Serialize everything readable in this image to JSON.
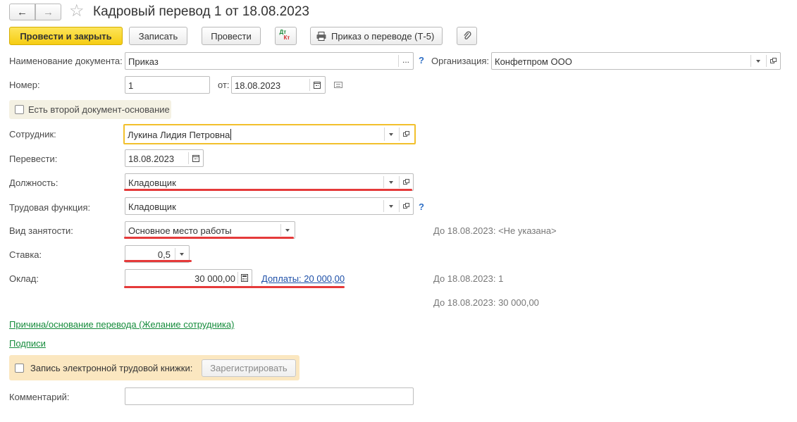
{
  "window": {
    "title": "Кадровый перевод 1 от 18.08.2023"
  },
  "toolbar": {
    "post_close_label": "Провести и закрыть",
    "save_label": "Записать",
    "post_label": "Провести",
    "dtkt_top": "Дт",
    "dtkt_bottom": "Кт",
    "print_label": "Приказ о переводе (Т-5)"
  },
  "form": {
    "doc_name_label": "Наименование документа:",
    "doc_name_value": "Приказ",
    "doc_name_more": "...",
    "help_mark": "?",
    "org_label": "Организация:",
    "org_value": "Конфетпром ООО",
    "number_label": "Номер:",
    "number_value": "1",
    "from_label": "от:",
    "from_value": "18.08.2023",
    "second_doc_label": "Есть второй документ-основание",
    "employee_label": "Сотрудник:",
    "employee_value": "Лукина Лидия Петровна",
    "transfer_label": "Перевести:",
    "transfer_value": "18.08.2023",
    "position_label": "Должность:",
    "position_value": "Кладовщик",
    "labor_function_label": "Трудовая функция:",
    "labor_function_value": "Кладовщик",
    "employment_type_label": "Вид занятости:",
    "employment_type_value": "Основное место работы",
    "employment_type_hint": "До 18.08.2023: <Не указана>",
    "rate_label": "Ставка:",
    "rate_value": "0,5",
    "rate_hint": "До 18.08.2023: 1",
    "salary_label": "Оклад:",
    "salary_value": "30 000,00",
    "allowances_link": "Доплаты: 20 000,00",
    "salary_hint": "До 18.08.2023: 30 000,00",
    "reason_link": "Причина/основание перевода (Желание сотрудника)",
    "signatures_link": "Подписи",
    "ewb_label": "Запись электронной трудовой книжки:",
    "ewb_register_label": "Зарегистрировать",
    "comment_label": "Комментарий:",
    "comment_value": ""
  },
  "colors": {
    "primary_button": "#f6cd12",
    "highlight_underline": "#e53a3a",
    "focus_border": "#f2c02c",
    "green_link": "#168c3c",
    "blue_link": "#1d4fa8",
    "ewb_panel": "#fbe7c0"
  }
}
